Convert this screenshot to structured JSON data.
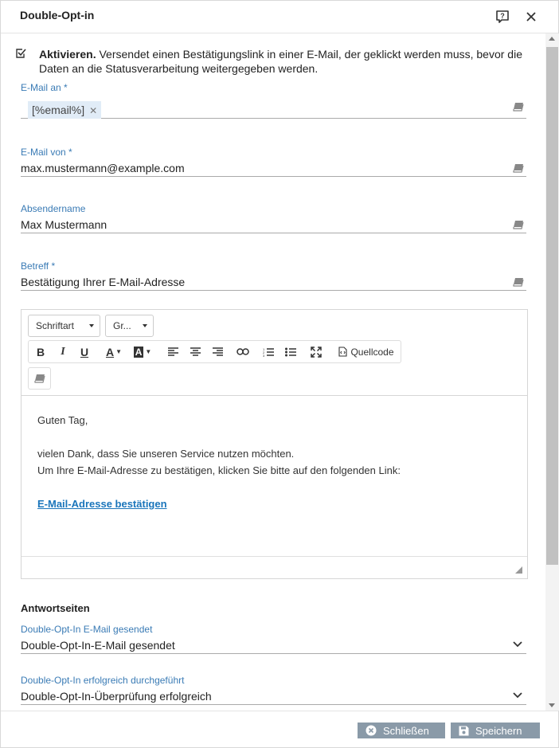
{
  "dialog": {
    "title": "Double-Opt-in"
  },
  "activate": {
    "checked": true,
    "label_bold": "Aktivieren.",
    "label_text": "Versendet einen Bestätigungslink in einer E-Mail, der geklickt werden muss, bevor die Daten an die Statusverarbeitung weitergegeben werden."
  },
  "fields": {
    "email_to": {
      "label": "E-Mail an *",
      "tag": "[%email%]"
    },
    "email_from": {
      "label": "E-Mail von *",
      "value": "max.mustermann@example.com"
    },
    "sender_name": {
      "label": "Absendername",
      "value": "Max Mustermann"
    },
    "subject": {
      "label": "Betreff *",
      "value": "Bestätigung Ihrer E-Mail-Adresse"
    }
  },
  "editor": {
    "font_combo": "Schriftart",
    "size_combo": "Gr...",
    "toolbar": {
      "bold": "B",
      "italic": "I",
      "underline": "U",
      "text_color": "A",
      "bg_color": "A",
      "source": "Quellcode"
    },
    "body": {
      "greeting": "Guten Tag,",
      "line1": "vielen Dank, dass Sie unseren Service nutzen möchten.",
      "line2": "Um Ihre E-Mail-Adresse zu bestätigen, klicken Sie bitte auf den folgenden Link:",
      "link": "E-Mail-Adresse bestätigen"
    }
  },
  "reply_pages": {
    "title": "Antwortseiten",
    "sent": {
      "label": "Double-Opt-In E-Mail gesendet",
      "value": "Double-Opt-In-E-Mail gesendet"
    },
    "success": {
      "label": "Double-Opt-In erfolgreich durchgeführt",
      "value": "Double-Opt-In-Überprüfung erfolgreich"
    }
  },
  "footer": {
    "close_label": "Schließen",
    "save_label": "Speichern"
  },
  "colors": {
    "label_blue": "#3a7bb5",
    "link_blue": "#1a75bb",
    "button_gray": "#8a9aa8",
    "tag_bg": "#e1ecf7"
  }
}
